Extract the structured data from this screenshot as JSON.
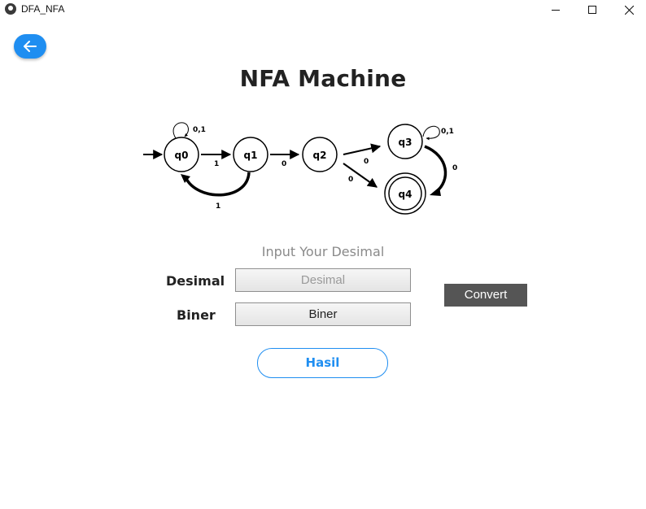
{
  "window": {
    "title": "DFA_NFA",
    "controls": [
      "minimize",
      "maximize",
      "close"
    ]
  },
  "back_button": {
    "icon": "arrow-left-icon"
  },
  "page": {
    "title": "NFA Machine"
  },
  "nfa_diagram": {
    "states": [
      {
        "id": "q0",
        "label": "q0",
        "initial": true,
        "accepting": false
      },
      {
        "id": "q1",
        "label": "q1",
        "initial": false,
        "accepting": false
      },
      {
        "id": "q2",
        "label": "q2",
        "initial": false,
        "accepting": false
      },
      {
        "id": "q3",
        "label": "q3",
        "initial": false,
        "accepting": false
      },
      {
        "id": "q4",
        "label": "q4",
        "initial": false,
        "accepting": true
      }
    ],
    "transitions": [
      {
        "from": "q0",
        "to": "q0",
        "label": "0,1"
      },
      {
        "from": "q0",
        "to": "q1",
        "label": "1"
      },
      {
        "from": "q1",
        "to": "q0",
        "label": "1"
      },
      {
        "from": "q1",
        "to": "q2",
        "label": "0"
      },
      {
        "from": "q2",
        "to": "q3",
        "label": "0"
      },
      {
        "from": "q2",
        "to": "q4",
        "label": "0"
      },
      {
        "from": "q3",
        "to": "q3",
        "label": "0,1"
      },
      {
        "from": "q3",
        "to": "q4",
        "label": "0"
      }
    ]
  },
  "form": {
    "heading": "Input Your Desimal",
    "desimal_label": "Desimal",
    "desimal_placeholder": "Desimal",
    "biner_label": "Biner",
    "biner_value": "Biner",
    "convert_label": "Convert",
    "hasil_label": "Hasil"
  },
  "colors": {
    "accent": "#1f8ef1",
    "convert_bg": "#555555",
    "heading_gray": "#8a8a8a"
  }
}
